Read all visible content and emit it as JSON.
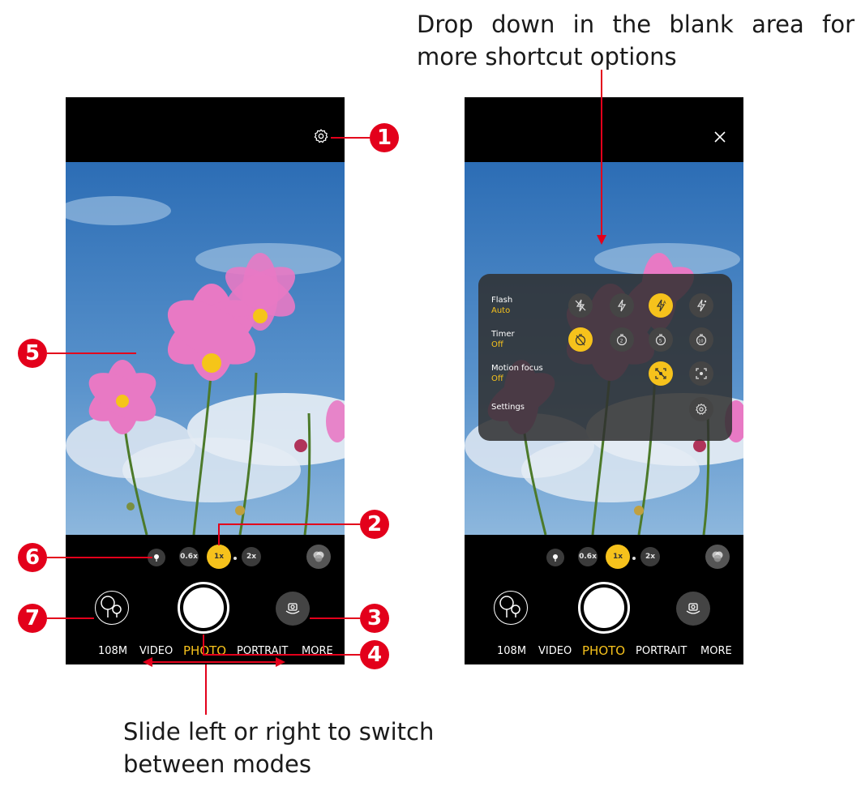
{
  "captions": {
    "top": "Drop down in the blank area for more shortcut options",
    "bottom": "Slide left or right to switch between modes"
  },
  "callouts": [
    "1",
    "2",
    "3",
    "4",
    "5",
    "6",
    "7"
  ],
  "camera": {
    "zoom_options": [
      "0.6x",
      "1x",
      "2x"
    ],
    "active_zoom": "1x",
    "modes": [
      "108M",
      "VIDEO",
      "PHOTO",
      "PORTRAIT",
      "MORE"
    ],
    "active_mode": "PHOTO"
  },
  "shortcut_panel": {
    "rows": [
      {
        "label": "Flash",
        "value": "Auto",
        "icons": [
          "flash-off-icon",
          "flash-on-icon",
          "flash-auto-icon",
          "flash-torch-icon"
        ],
        "active": 2
      },
      {
        "label": "Timer",
        "value": "Off",
        "icons": [
          "timer-off-icon",
          "timer-2-icon",
          "timer-5-icon",
          "timer-10-icon"
        ],
        "active": 0
      },
      {
        "label": "Motion focus",
        "value": "Off",
        "icons": [
          "motion-focus-off-icon",
          "motion-focus-on-icon"
        ],
        "active": 0
      },
      {
        "label": "Settings",
        "value": "",
        "icons": [
          "gear-icon"
        ],
        "active": -1
      }
    ]
  },
  "colors": {
    "accent": "#f6c21c",
    "callout": "#e3001b",
    "arrow": "#e3001b"
  }
}
